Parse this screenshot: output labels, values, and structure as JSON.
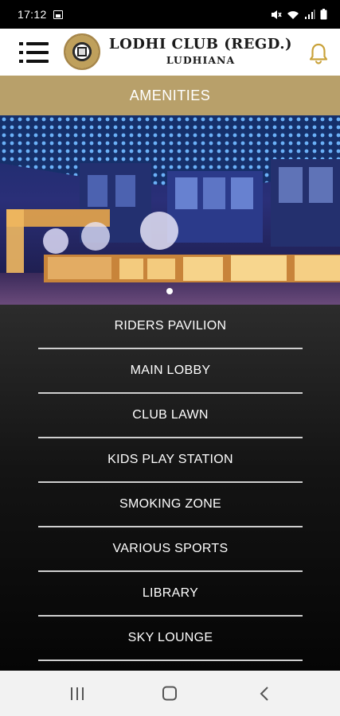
{
  "status_bar": {
    "time": "17:12"
  },
  "header": {
    "title": "LODHI CLUB (REGD.)",
    "subtitle": "LUDHIANA"
  },
  "section": {
    "title": "AMENITIES"
  },
  "carousel": {
    "slide_count": 1,
    "active_index": 0
  },
  "amenities": [
    "RIDERS PAVILION",
    "MAIN LOBBY",
    "CLUB LAWN",
    "KIDS PLAY STATION",
    "SMOKING ZONE",
    "VARIOUS SPORTS",
    "LIBRARY",
    "SKY LOUNGE"
  ],
  "colors": {
    "accent_gold": "#b8a06a",
    "bell_gold": "#c9a23a",
    "list_bg": "#141414",
    "divider": "#cfcfcf"
  },
  "icons": {
    "menu": "menu-icon",
    "notification": "bell-icon",
    "nav_recents": "recents-icon",
    "nav_home": "home-icon",
    "nav_back": "back-icon"
  }
}
